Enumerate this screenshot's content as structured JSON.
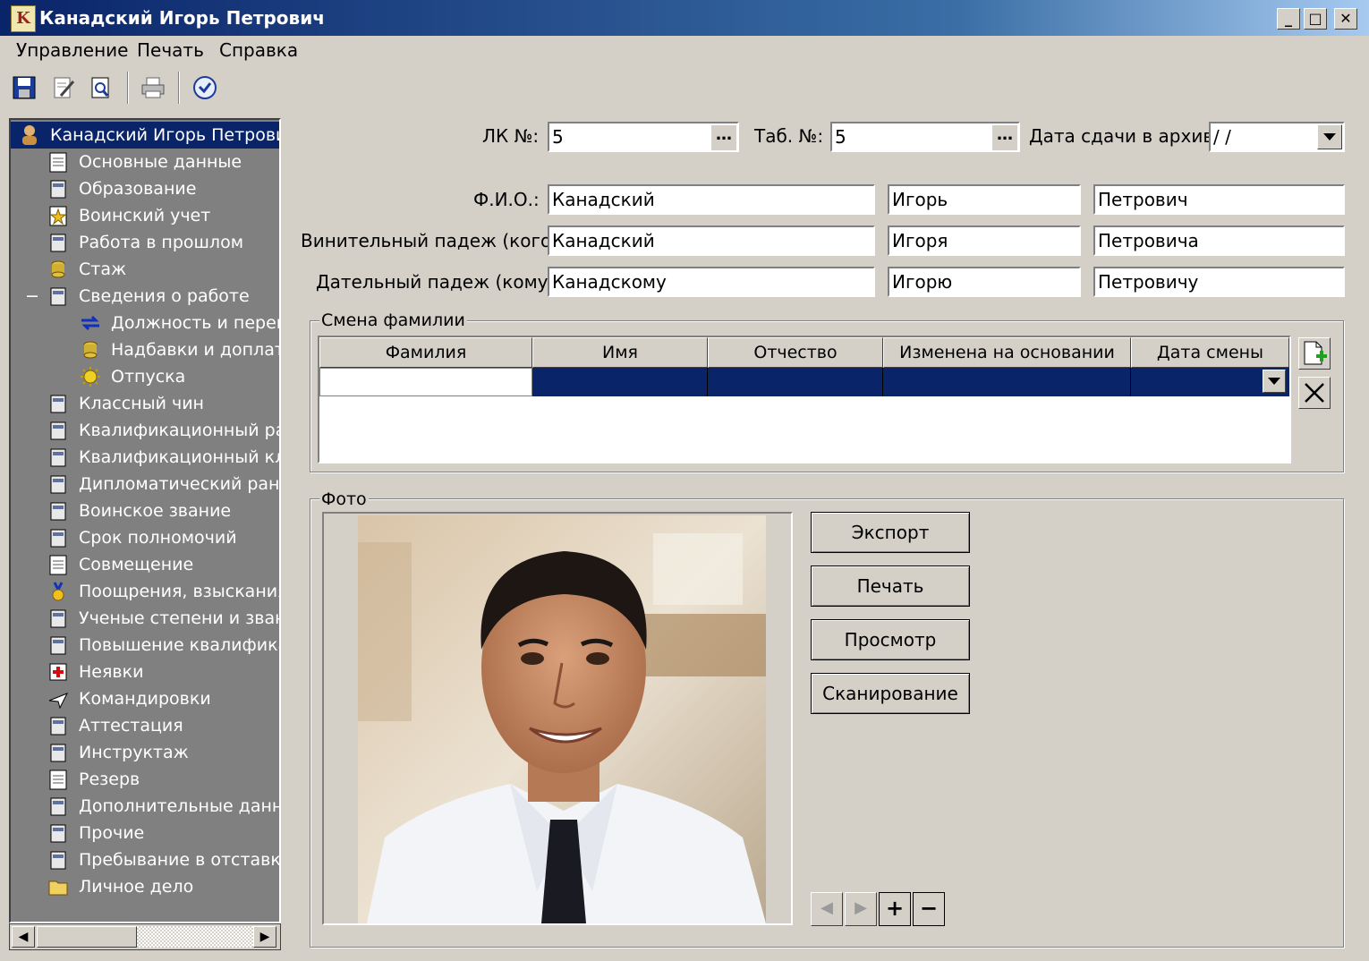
{
  "window": {
    "title": "Канадский Игорь Петрович",
    "minimize": "_",
    "maximize": "□",
    "close": "✕"
  },
  "menu": {
    "items": [
      "Управление",
      "Печать",
      "Справка"
    ]
  },
  "toolbar": {
    "buttons": [
      "save-icon",
      "edit-icon",
      "preview-icon",
      "print-icon",
      "clock-icon"
    ]
  },
  "tree": {
    "root": "Канадский Игорь Петрович",
    "items": [
      {
        "label": "Основные данные",
        "icon": "document-icon"
      },
      {
        "label": "Образование",
        "icon": "education-icon"
      },
      {
        "label": "Воинский учет",
        "icon": "star-icon"
      },
      {
        "label": "Работа в прошлом",
        "icon": "briefcase-icon"
      },
      {
        "label": "Стаж",
        "icon": "coins-icon"
      },
      {
        "label": "Сведения о работе",
        "icon": "people-icon",
        "expanded": true,
        "expander": "−"
      },
      {
        "label": "Должность и перем",
        "icon": "arrows-icon",
        "child": true
      },
      {
        "label": "Надбавки и доплат",
        "icon": "coins-icon",
        "child": true
      },
      {
        "label": "Отпуска",
        "icon": "sun-icon",
        "child": true
      },
      {
        "label": "Классный чин",
        "icon": "rank-icon"
      },
      {
        "label": "Квалификационный ра:",
        "icon": "tools-icon"
      },
      {
        "label": "Квалификационный кла",
        "icon": "ruler-icon"
      },
      {
        "label": "Дипломатический ранг",
        "icon": "diplomat-icon"
      },
      {
        "label": "Воинское звание",
        "icon": "insignia-icon"
      },
      {
        "label": "Срок полномочий",
        "icon": "calendar-icon"
      },
      {
        "label": "Совмещение",
        "icon": "document-icon"
      },
      {
        "label": "Поощрения, взыскания",
        "icon": "medal-icon"
      },
      {
        "label": "Ученые степени и зван",
        "icon": "diploma-icon"
      },
      {
        "label": "Повышение квалифика",
        "icon": "book-icon"
      },
      {
        "label": "Неявки",
        "icon": "redcross-icon"
      },
      {
        "label": "Командировки",
        "icon": "plane-icon"
      },
      {
        "label": "Аттестация",
        "icon": "certificate-icon"
      },
      {
        "label": "Инструктаж",
        "icon": "instructor-icon"
      },
      {
        "label": "Резерв",
        "icon": "document-icon"
      },
      {
        "label": "Дополнительные данны",
        "icon": "notes-icon"
      },
      {
        "label": "Прочие",
        "icon": "list-icon"
      },
      {
        "label": "Пребывание в отставке",
        "icon": "retire-icon"
      },
      {
        "label": "Личное дело",
        "icon": "folder-icon"
      }
    ]
  },
  "form": {
    "lk_label": "ЛК №:",
    "lk_value": "5",
    "tab_label": "Таб. №:",
    "tab_value": "5",
    "archive_label": "Дата сдачи в архив:",
    "archive_value": " / /",
    "ellipsis": "…",
    "fio_label": "Ф.И.О.:",
    "fio": [
      "Канадский",
      "Игорь",
      "Петрович"
    ],
    "acc_label": "Винительный падеж (кого):",
    "acc": [
      "Канадский",
      "Игоря",
      "Петровича"
    ],
    "dat_label": "Дательный падеж (кому):",
    "dat": [
      "Канадскому",
      "Игорю",
      "Петровичу"
    ]
  },
  "surname_change": {
    "title": "Смена фамилии",
    "columns": [
      "Фамилия",
      "Имя",
      "Отчество",
      "Изменена на основании",
      "Дата смены"
    ],
    "rows": [
      [
        "",
        "",
        "",
        "",
        ""
      ]
    ]
  },
  "photo": {
    "title": "Фото",
    "buttons": [
      "Экспорт",
      "Печать",
      "Просмотр",
      "Сканирование"
    ],
    "nav": [
      "◀",
      "▶",
      "+",
      "−"
    ]
  },
  "colors": {
    "selection": "#0a246a",
    "tree_bg": "#808080",
    "face": "#d4d0c8"
  }
}
